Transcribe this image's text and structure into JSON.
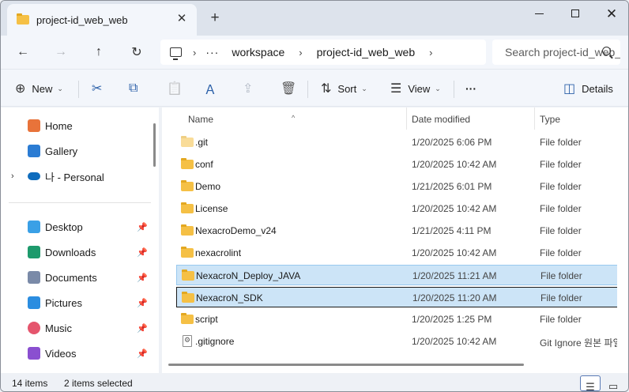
{
  "window": {
    "tab_title": "project-id_web_web",
    "close_tab_glyph": "✕",
    "new_tab_glyph": "+",
    "close_glyph": "✕"
  },
  "nav": {
    "back_glyph": "←",
    "forward_glyph": "→",
    "up_glyph": "↑",
    "refresh_glyph": "↻",
    "breadcrumb": [
      "workspace",
      "project-id_web_web"
    ],
    "overflow_glyph": "···",
    "sep_glyph": "›",
    "search_placeholder": "Search project-id_web_web"
  },
  "toolbar": {
    "new_label": "New",
    "sort_label": "Sort",
    "view_label": "View",
    "more_glyph": "···",
    "details_label": "Details",
    "chevron": "⌄",
    "icons": {
      "new": "⊕",
      "cut": "✂",
      "copy": "⧉",
      "paste": "📋",
      "rename": "Ａ",
      "share": "⇪",
      "delete": "🗑",
      "sort": "⇅",
      "view": "☰",
      "details": "◫"
    }
  },
  "sidebar": {
    "top_items": [
      {
        "label": "Home",
        "icon": "home-icon",
        "color": "#e8733a"
      },
      {
        "label": "Gallery",
        "icon": "gallery-icon",
        "color": "#2b7cd3"
      },
      {
        "label": "나 - Personal",
        "icon": "onedrive-icon",
        "color": "#0f6cbd"
      }
    ],
    "expand_glyph": "›",
    "pinned_items": [
      {
        "label": "Desktop",
        "icon": "desktop-icon",
        "color": "#3aa0e6"
      },
      {
        "label": "Downloads",
        "icon": "download-icon",
        "color": "#1d9a6c"
      },
      {
        "label": "Documents",
        "icon": "documents-icon",
        "color": "#7a8aa8"
      },
      {
        "label": "Pictures",
        "icon": "pictures-icon",
        "color": "#2b8de0"
      },
      {
        "label": "Music",
        "icon": "music-icon",
        "color": "#e5556d"
      },
      {
        "label": "Videos",
        "icon": "videos-icon",
        "color": "#8a4fd0"
      }
    ],
    "pin_glyph": "📌"
  },
  "list": {
    "columns": [
      "Name",
      "Date modified",
      "Type"
    ],
    "sort_caret": "^",
    "rows": [
      {
        "name": ".git",
        "date": "1/20/2025 6:06 PM",
        "type": "File folder",
        "kind": "folder",
        "faded": true
      },
      {
        "name": "conf",
        "date": "1/20/2025 10:42 AM",
        "type": "File folder",
        "kind": "folder"
      },
      {
        "name": "Demo",
        "date": "1/21/2025 6:01 PM",
        "type": "File folder",
        "kind": "folder"
      },
      {
        "name": "License",
        "date": "1/20/2025 10:42 AM",
        "type": "File folder",
        "kind": "folder"
      },
      {
        "name": "NexacroDemo_v24",
        "date": "1/21/2025 4:11 PM",
        "type": "File folder",
        "kind": "folder"
      },
      {
        "name": "nexacrolint",
        "date": "1/20/2025 10:42 AM",
        "type": "File folder",
        "kind": "folder"
      },
      {
        "name": "NexacroN_Deploy_JAVA",
        "date": "1/20/2025 11:21 AM",
        "type": "File folder",
        "kind": "folder",
        "selected": true
      },
      {
        "name": "NexacroN_SDK",
        "date": "1/20/2025 11:20 AM",
        "type": "File folder",
        "kind": "folder",
        "selected": true,
        "focused": true
      },
      {
        "name": "script",
        "date": "1/20/2025 1:25 PM",
        "type": "File folder",
        "kind": "folder"
      },
      {
        "name": ".gitignore",
        "date": "1/20/2025 10:42 AM",
        "type": "Git Ignore 원본 파일",
        "kind": "file"
      }
    ]
  },
  "status": {
    "item_count": "14 items",
    "selected_count": "2 items selected",
    "details_view_glyph": "☰",
    "tiles_view_glyph": "▭"
  }
}
